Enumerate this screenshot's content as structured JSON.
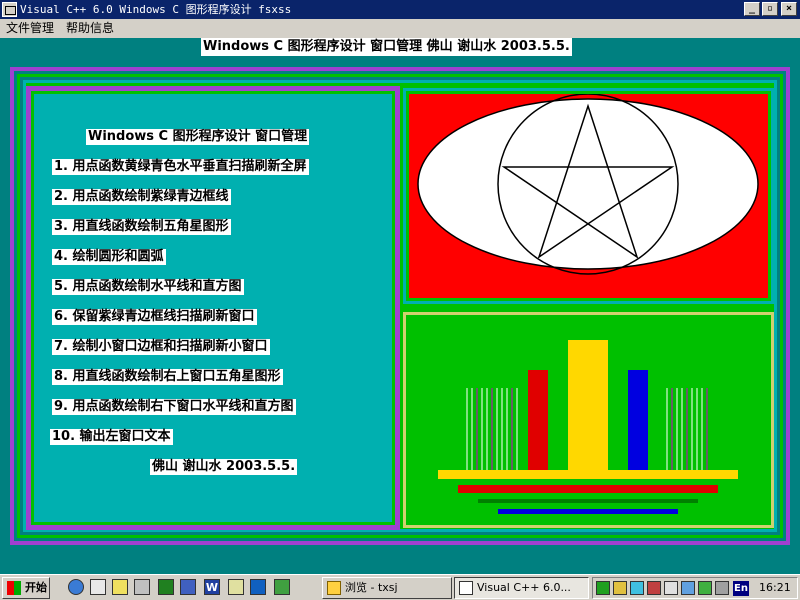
{
  "window": {
    "title": "Visual C++ 6.0 Windows C 图形程序设计 fsxss",
    "min_label": "_",
    "max_label": "▫",
    "close_label": "×"
  },
  "menu": {
    "items": [
      "文件管理",
      "帮助信息"
    ]
  },
  "headline": "Windows C 图形程序设计 窗口管理  佛山 谢山水 2003.5.5.",
  "left_panel": {
    "title": "Windows C 图形程序设计 窗口管理",
    "lines": [
      "1. 用点函数黄绿青色水平垂直扫描刷新全屏",
      "2. 用点函数绘制紫绿青边框线",
      "3. 用直线函数绘制五角星图形",
      "4. 绘制圆形和圆弧",
      "5. 用点函数绘制水平线和直方图",
      "6. 保留紫绿青边框线扫描刷新窗口",
      "7. 绘制小窗口边框和扫描刷新小窗口",
      "8. 用直线函数绘制右上窗口五角星图形",
      "9. 用点函数绘制右下窗口水平线和直方图",
      "10. 输出左窗口文本"
    ],
    "signature": "佛山 谢山水 2003.5.5."
  },
  "colors": {
    "desktop": "#008080",
    "purple": "#a040d0",
    "green": "#00c000",
    "cyan": "#00b0b0",
    "red": "#ff0000",
    "bar_red": "#e00000",
    "yellow": "#ffd800",
    "blue": "#0000e0"
  },
  "taskbar": {
    "start_label": "开始",
    "tasks": [
      "浏览 - txsj",
      "Visual C++ 6.0..."
    ],
    "tray_lang": "En",
    "clock": "16:21"
  }
}
